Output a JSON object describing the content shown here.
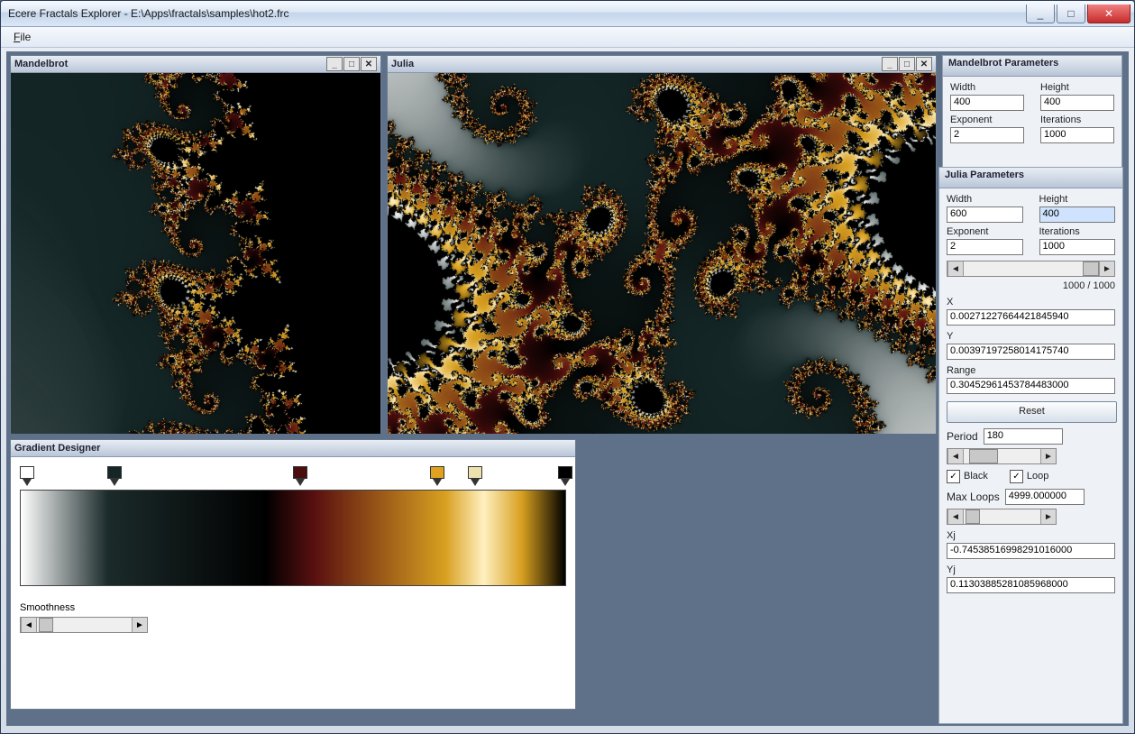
{
  "window": {
    "title": "Ecere Fractals Explorer - E:\\Apps\\fractals\\samples\\hot2.frc"
  },
  "menu": {
    "file": "File"
  },
  "mandelbrotWin": {
    "title": "Mandelbrot"
  },
  "juliaWin": {
    "title": "Julia"
  },
  "gradientWin": {
    "title": "Gradient Designer",
    "smoothness": "Smoothness"
  },
  "mandelParams": {
    "title": "Mandelbrot Parameters",
    "widthLabel": "Width",
    "width": "400",
    "heightLabel": "Height",
    "height": "400",
    "exponentLabel": "Exponent",
    "exponent": "2",
    "iterationsLabel": "Iterations",
    "iterations": "1000"
  },
  "juliaParams": {
    "title": "Julia Parameters",
    "widthLabel": "Width",
    "width": "600",
    "heightLabel": "Height",
    "height": "400",
    "exponentLabel": "Exponent",
    "exponent": "2",
    "iterationsLabel": "Iterations",
    "iterations": "1000",
    "progress": "1000 / 1000",
    "xLabel": "X",
    "x": "0.00271227664421845940",
    "yLabel": "Y",
    "y": "0.00397197258014175740",
    "rangeLabel": "Range",
    "range": "0.30452961453784483000",
    "reset": "Reset",
    "periodLabel": "Period",
    "period": "180",
    "blackLabel": "Black",
    "black": true,
    "loopLabel": "Loop",
    "loop": true,
    "maxLoopsLabel": "Max Loops",
    "maxLoops": "4999.000000",
    "xjLabel": "Xj",
    "xj": "-0.74538516998291016000",
    "yjLabel": "Yj",
    "yj": "0.11303885281085968000"
  },
  "gradientStops": [
    {
      "pos": 0.0,
      "color": "#ffffff"
    },
    {
      "pos": 0.16,
      "color": "#142626"
    },
    {
      "pos": 0.5,
      "color": "#4a0e0e"
    },
    {
      "pos": 0.75,
      "color": "#e0a020"
    },
    {
      "pos": 0.82,
      "color": "#efe0b0"
    },
    {
      "pos": 0.985,
      "color": "#000000"
    }
  ],
  "icons": {
    "min": "_",
    "max": "□",
    "close": "✕",
    "restore": "❐",
    "left": "◄",
    "right": "►",
    "check": "✓"
  }
}
